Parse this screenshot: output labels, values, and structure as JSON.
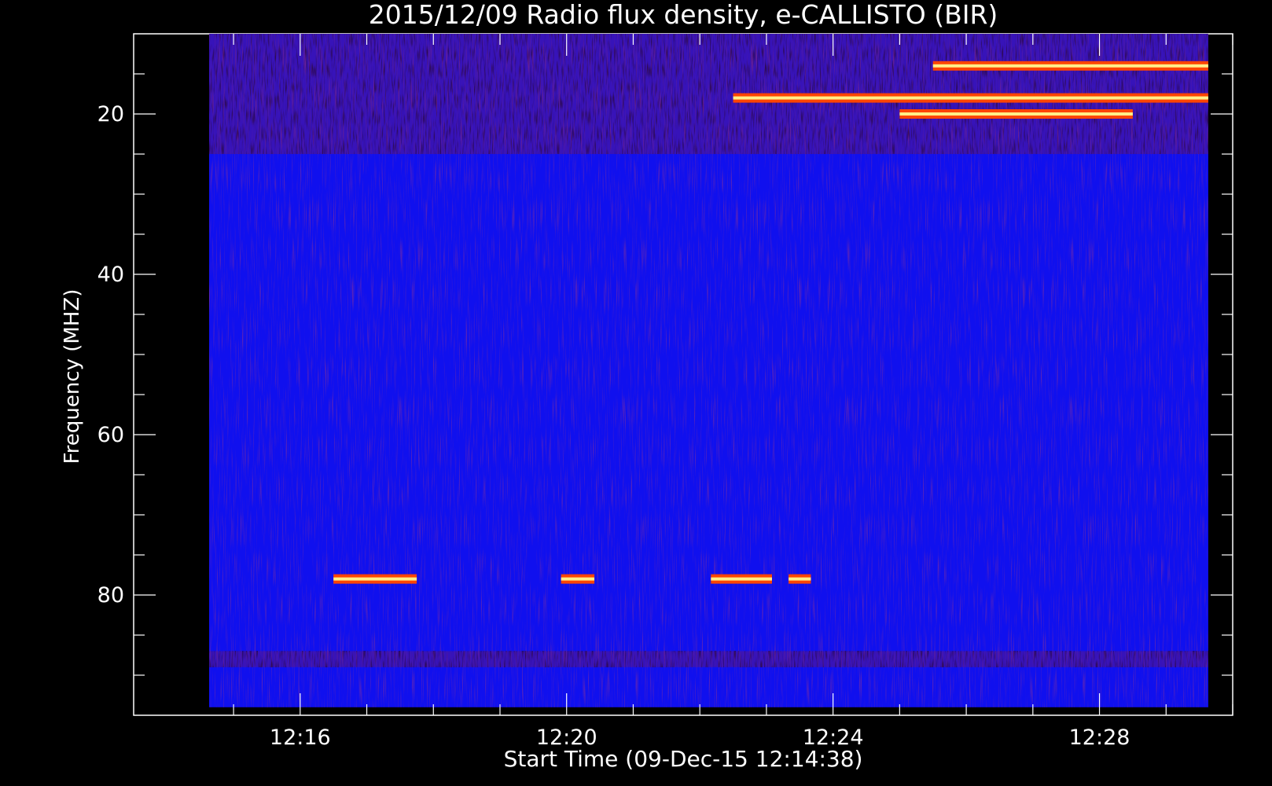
{
  "chart_data": {
    "type": "heatmap",
    "title": "2015/12/09  Radio flux density, e-CALLISTO (BIR)",
    "xlabel": "Start Time (09-Dec-15 12:14:38)",
    "ylabel": "Frequency (MHZ)",
    "x_ticks": [
      "12:16",
      "12:20",
      "12:24",
      "12:28"
    ],
    "y_ticks": [
      "20",
      "40",
      "60",
      "80"
    ],
    "x_range": [
      "12:13:30",
      "12:30:00"
    ],
    "y_range": [
      95,
      10
    ],
    "y_axis_inverted": true,
    "data_extent": {
      "time_start": "12:14:38",
      "time_end": "12:29:38",
      "freq_min": 10,
      "freq_max": 94
    },
    "background_color": "#1010ee",
    "colors": {
      "background": "#000000",
      "low": "#000000",
      "base": "#1010ee",
      "mid": "#aa1a1a",
      "high": "#ff4400",
      "peak": "#ffee88"
    },
    "features": [
      {
        "type": "rfi_band_noisy",
        "freq_from": 10,
        "freq_to": 25,
        "time_from": "12:14:38",
        "time_to": "12:29:38"
      },
      {
        "type": "rfi_band_noisy",
        "freq_from": 87,
        "freq_to": 89,
        "time_from": "12:14:38",
        "time_to": "12:29:38"
      },
      {
        "type": "emission_line",
        "freq": 78,
        "time_from": "12:16:30",
        "time_to": "12:17:45"
      },
      {
        "type": "emission_line",
        "freq": 78,
        "time_from": "12:19:55",
        "time_to": "12:20:25"
      },
      {
        "type": "emission_line",
        "freq": 78,
        "time_from": "12:22:10",
        "time_to": "12:23:05"
      },
      {
        "type": "emission_line",
        "freq": 78,
        "time_from": "12:23:20",
        "time_to": "12:23:40"
      },
      {
        "type": "emission_line",
        "freq": 20,
        "time_from": "12:25:00",
        "time_to": "12:28:30"
      },
      {
        "type": "emission_line",
        "freq": 18,
        "time_from": "12:22:30",
        "time_to": "12:29:38"
      },
      {
        "type": "emission_line",
        "freq": 14,
        "time_from": "12:25:30",
        "time_to": "12:29:38"
      }
    ]
  }
}
